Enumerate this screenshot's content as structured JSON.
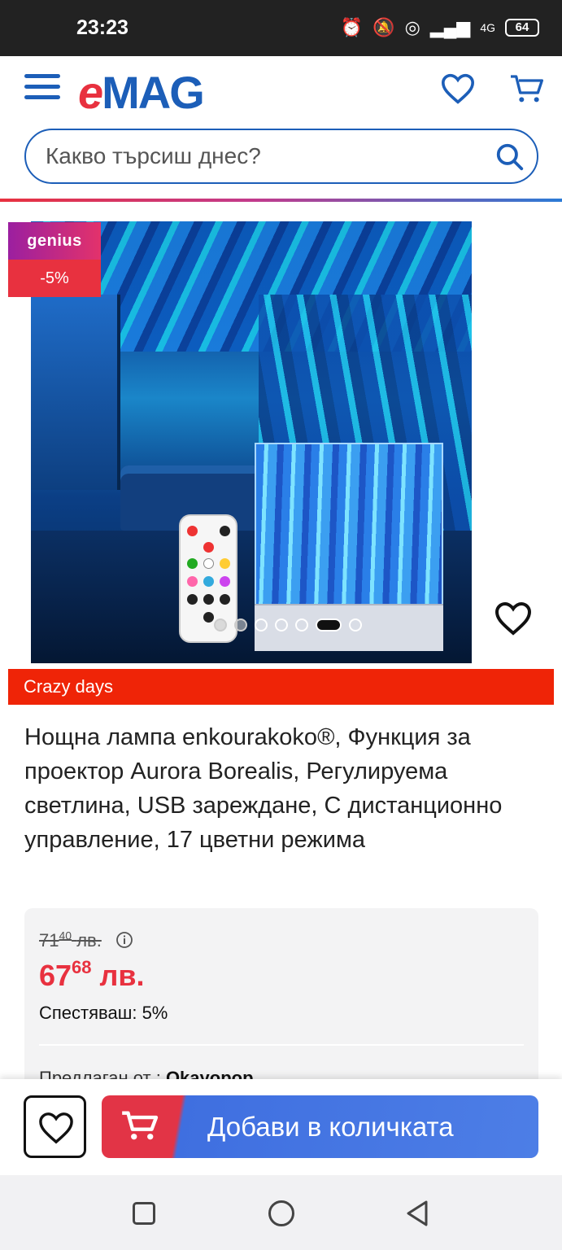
{
  "status_bar": {
    "time": "23:23",
    "network": "4G",
    "battery": "64"
  },
  "header": {
    "logo_e": "e",
    "logo_rest": "MAG",
    "search_placeholder": "Какво търсиш днес?"
  },
  "gallery": {
    "badge_genius": "genius",
    "badge_discount": "-5%",
    "total_images": 7,
    "active_image_index": 5
  },
  "promo_banner": "Crazy days",
  "product": {
    "title": "Нощна лампа enkourakoko®, Функция за проектор Aurora Borealis, Регулируема светлина, USB зареждане, С дистанционно управление, 17 цветни режима",
    "old_price_int": "71",
    "old_price_dec": "40",
    "old_price_currency": "лв.",
    "new_price_int": "67",
    "new_price_dec": "68",
    "new_price_currency": "лв.",
    "savings": "Спестяваш: 5%",
    "seller_label": "Предлаган от :",
    "seller_name": "Okayopop"
  },
  "bottom_bar": {
    "add_to_cart_label": "Добави в количката"
  },
  "colors": {
    "brand_blue": "#1c5eb8",
    "brand_red": "#e8313f",
    "promo_red": "#ef2407"
  }
}
